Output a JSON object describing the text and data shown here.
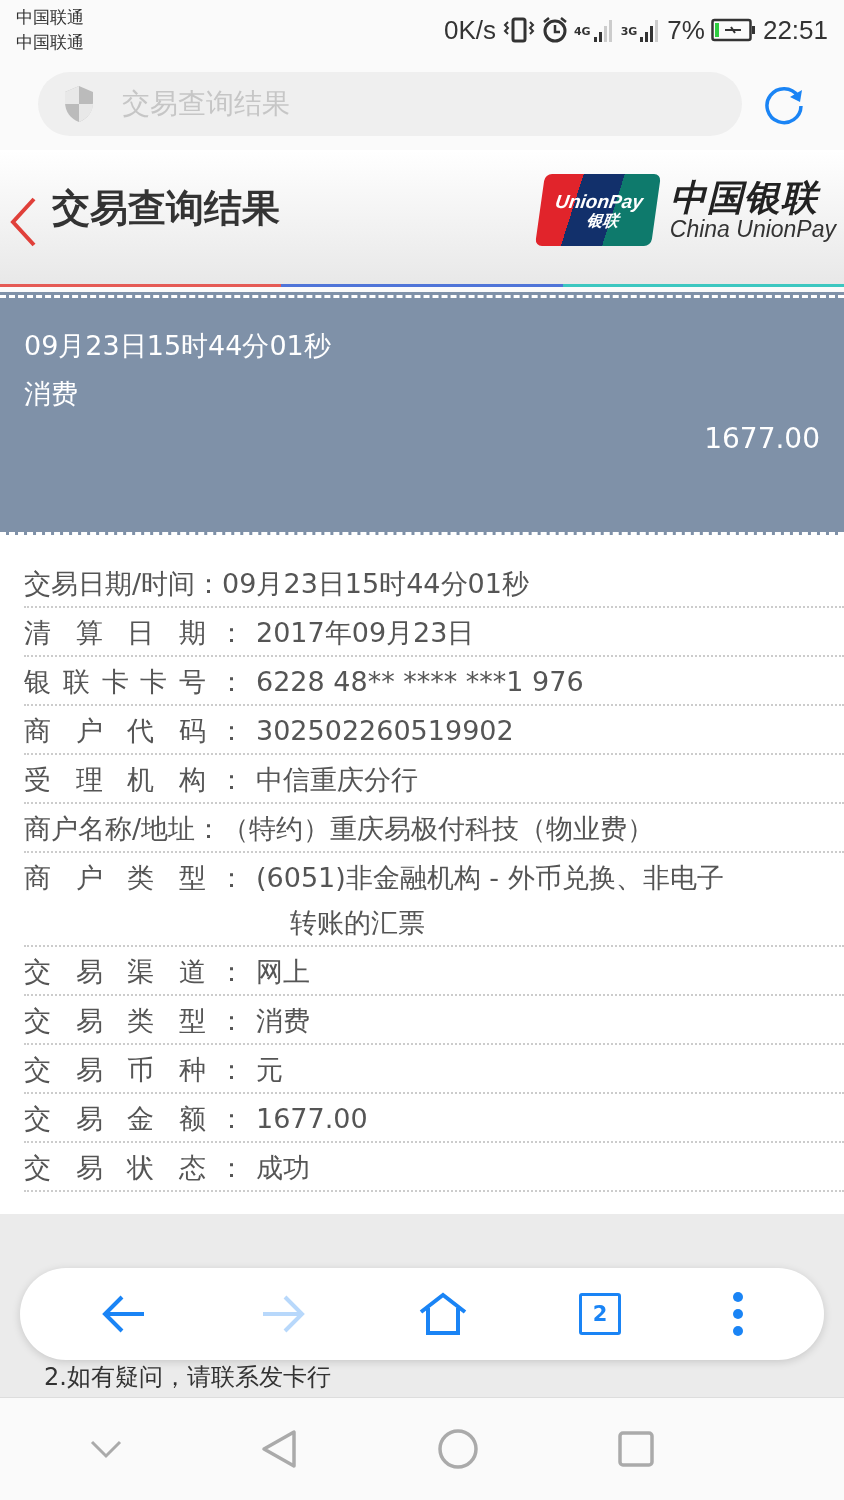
{
  "status_bar": {
    "carriers": [
      "中国联通",
      "中国联通"
    ],
    "speed": "0K/s",
    "network_1": "4G",
    "network_2": "3G",
    "battery": "7%",
    "time": "22:51"
  },
  "address_bar": {
    "title": "交易查询结果"
  },
  "header": {
    "title": "交易查询结果",
    "logo_card_text": "UnionPay",
    "logo_card_sub": "银联",
    "logo_cn": "中国银联",
    "logo_en": "China UnionPay"
  },
  "summary": {
    "datetime": "09月23日15时44分01秒",
    "type": "消费",
    "amount": "1677.00"
  },
  "details": [
    {
      "kind": "wide",
      "label": "交易日期/时间：",
      "value": "09月23日15时44分01秒"
    },
    {
      "kind": "justified",
      "label": "清算日期",
      "value": "2017年09月23日"
    },
    {
      "kind": "justified",
      "label": "银联卡卡号",
      "value": "6228 48** **** ***1 976"
    },
    {
      "kind": "justified",
      "label": "商户代码",
      "value": "302502260519902"
    },
    {
      "kind": "justified",
      "label": "受理机构",
      "value": "中信重庆分行"
    },
    {
      "kind": "wide",
      "label": "商户名称/地址：",
      "value": "（特约）重庆易极付科技（物业费）"
    },
    {
      "kind": "justified",
      "label": "商户类型",
      "value": "(6051)非金融机构 - 外币兑换、非电子",
      "value_2": "转账的汇票"
    },
    {
      "kind": "justified",
      "label": "交易渠道",
      "value": "网上"
    },
    {
      "kind": "justified",
      "label": "交易类型",
      "value": "消费"
    },
    {
      "kind": "justified",
      "label": "交易币种",
      "value": "元"
    },
    {
      "kind": "justified",
      "label": "交易金额",
      "value": "1677.00"
    },
    {
      "kind": "justified",
      "label": "交易状态",
      "value": "成功"
    }
  ],
  "colon": "：",
  "tips": [
    "2.如有疑问，请联系发卡行"
  ],
  "toolbar": {
    "tab_count": "2",
    "forward_disabled": true
  }
}
